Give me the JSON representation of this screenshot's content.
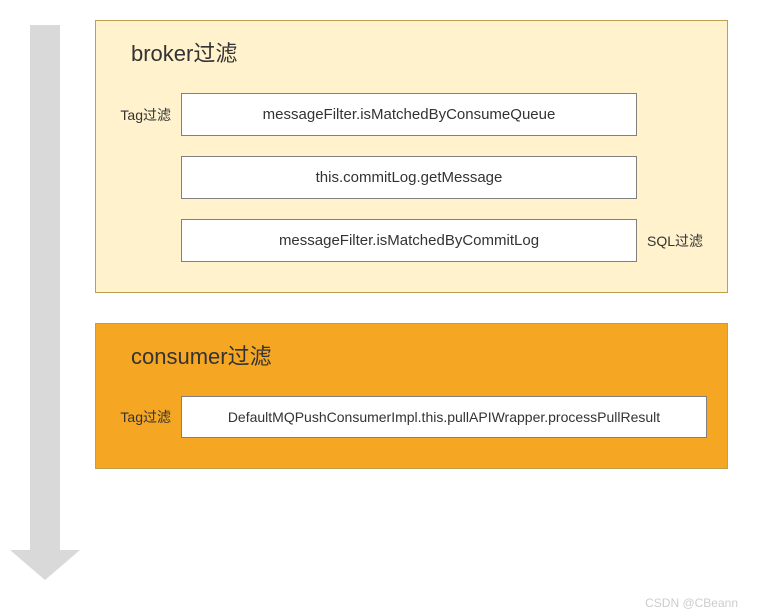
{
  "broker": {
    "title": "broker过滤",
    "rows": [
      {
        "labelLeft": "Tag过滤",
        "box": "messageFilter.isMatchedByConsumeQueue",
        "labelRight": ""
      },
      {
        "labelLeft": "",
        "box": "this.commitLog.getMessage",
        "labelRight": ""
      },
      {
        "labelLeft": "",
        "box": "messageFilter.isMatchedByCommitLog",
        "labelRight": "SQL过滤"
      }
    ]
  },
  "consumer": {
    "title": "consumer过滤",
    "rows": [
      {
        "labelLeft": "Tag过滤",
        "box": "DefaultMQPushConsumerImpl.this.pullAPIWrapper.processPullResult",
        "labelRight": ""
      }
    ]
  },
  "watermark": "CSDN @CBeann"
}
